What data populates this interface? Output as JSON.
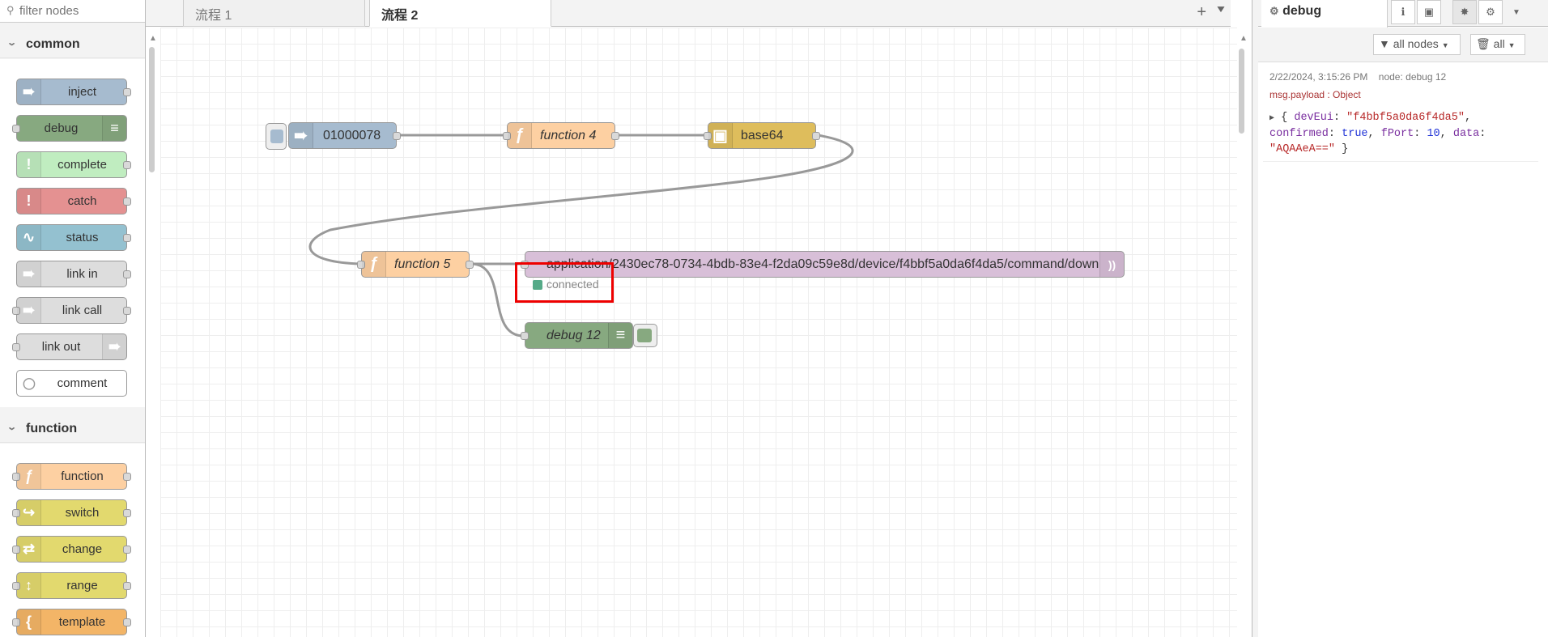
{
  "palette": {
    "filter_placeholder": "filter nodes",
    "categories": [
      {
        "name": "common"
      },
      {
        "name": "function"
      }
    ],
    "common_nodes": [
      "inject",
      "debug",
      "complete",
      "catch",
      "status",
      "link in",
      "link call",
      "link out",
      "comment"
    ],
    "function_nodes": [
      "function",
      "switch",
      "change",
      "range",
      "template"
    ]
  },
  "tabs": [
    {
      "label": "流程 1"
    },
    {
      "label": "流程 2"
    }
  ],
  "workspace": {
    "nodes": {
      "inject": "01000078",
      "function4": "function 4",
      "base64": "base64",
      "function5": "function 5",
      "mqtt_out": "application/2430ec78-0734-4bdb-83e4-f2da09c59e8d/device/f4bbf5a0da6f4da5/command/down",
      "debug12": "debug 12"
    },
    "status": "connected"
  },
  "sidebar": {
    "title": "debug",
    "filter_label": "all nodes",
    "clear_label": "all",
    "message": {
      "timestamp": "2/22/2024, 3:15:26 PM",
      "node": "node: debug 12",
      "path": "msg.payload : Object",
      "json_open": "{ ",
      "key1": "devEui",
      "val1": "\"f4bbf5a0da6f4da5\"",
      "key2": "confirmed",
      "val2": "true",
      "key3": "fPort",
      "val3": "10",
      "key4": "data",
      "val4": "\"AQAAeA==\"",
      "json_close": " }"
    }
  },
  "colors": {
    "inject": "#a6bbcf",
    "debug": "#87a980",
    "complete": "#c0edc0",
    "catch": "#e49191",
    "status": "#94c1d0",
    "link": "#dddddd",
    "function": "#fdd0a2",
    "switch": "#e2d96e",
    "template": "#f3b567",
    "base64": "#debd5c",
    "mqtt": "#d8bfd8",
    "highlight": "#ee0000"
  }
}
